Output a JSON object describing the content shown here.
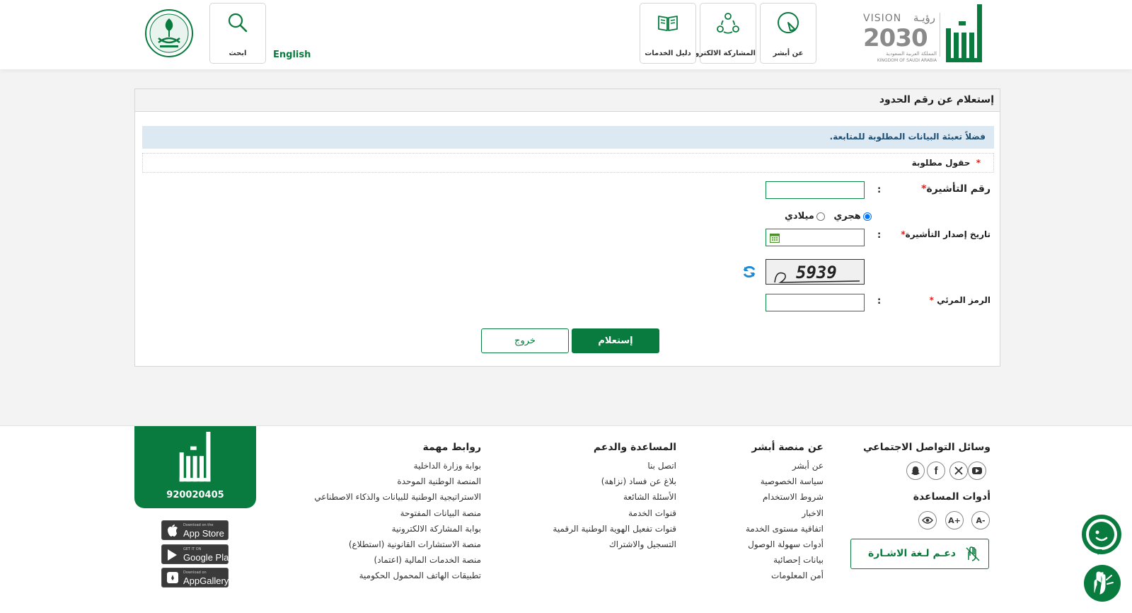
{
  "header": {
    "vision": {
      "word": "VISION",
      "arabic_word": "رؤيـة",
      "year": "2030",
      "kingdom_ar": "المملكة العربية السعودية",
      "kingdom_en": "KINGDOM OF SAUDI ARABIA"
    },
    "nav": [
      {
        "label": "عن أبشر",
        "icon": "absher-logo-icon"
      },
      {
        "label": "المشاركة الالكترونية",
        "icon": "participation-icon"
      },
      {
        "label": "دليل الخدمات",
        "icon": "book-icon"
      }
    ],
    "language_link": "English",
    "search_label": "ابحث"
  },
  "page": {
    "title": "إستعلام عن رقم الحدود",
    "info_message": "فضلاً تعبئة البيانات المطلوبة للمتابعة.",
    "required_note": "حقول مطلوبة",
    "required_star": "*"
  },
  "form": {
    "visa_number_label": "رقم التأشيرة",
    "calendar": {
      "hijri": "هجري",
      "gregorian": "ميلادي",
      "selected": "hijri"
    },
    "issue_date_label": "تاريخ إصدار التأشيرة",
    "captcha_text": "5939",
    "visual_code_label": "الرمز المرئي",
    "colon": ":",
    "submit_label": "إستعلام",
    "exit_label": "خروج"
  },
  "footer": {
    "social": {
      "title": "وسائل التواصل الاجتماعي",
      "icons": [
        "youtube-icon",
        "x-icon",
        "facebook-icon",
        "snapchat-icon"
      ]
    },
    "tools": {
      "title": "أدوات المساعدة",
      "buttons": [
        "-A",
        "+A"
      ],
      "eye_icon": "eye-icon"
    },
    "sign_language": "دعـم لـغة الاشـارة",
    "about": {
      "title": "عن منصة أبشر",
      "links": [
        "عن أبشر",
        "سياسة الخصوصية",
        "شروط الاستخدام",
        "الاخبار",
        "اتفاقية مستوى الخدمة",
        "أدوات سهولة الوصول",
        "بيانات إحصائية",
        "أمن المعلومات"
      ]
    },
    "support": {
      "title": "المساعدة والدعم",
      "links": [
        "اتصل بنا",
        "بلاغ عن فساد (نزاهة)",
        "الأسئلة الشائعة",
        "قنوات الخدمة",
        "قنوات تفعيل الهوية الوطنية الرقمية",
        "التسجيل والاشتراك"
      ]
    },
    "links": {
      "title": "روابط مهمة",
      "links": [
        "بوابة وزارة الداخلية",
        "المنصة الوطنية الموحدة",
        "الاستراتيجية الوطنية للبيانات والذكاء الاصطناعي",
        "منصة البيانات المفتوحة",
        "بوابة المشاركة الالكترونية",
        "منصة الاستشارات القانونية (استطلاع)",
        "منصة الخدمات المالية (اعتماد)",
        "تطبيقات الهاتف المحمول الحكومية"
      ]
    },
    "phone": "920020405",
    "stores": [
      {
        "small": "Download on the",
        "big": "App Store"
      },
      {
        "small": "GET IT ON",
        "big": "Google Play"
      },
      {
        "small": "Download on",
        "big": "AppGallery"
      }
    ]
  },
  "colors": {
    "primary": "#0a7b3e",
    "info_bg": "#dde9f2",
    "info_text": "#1e4f73",
    "required": "#e02020"
  }
}
